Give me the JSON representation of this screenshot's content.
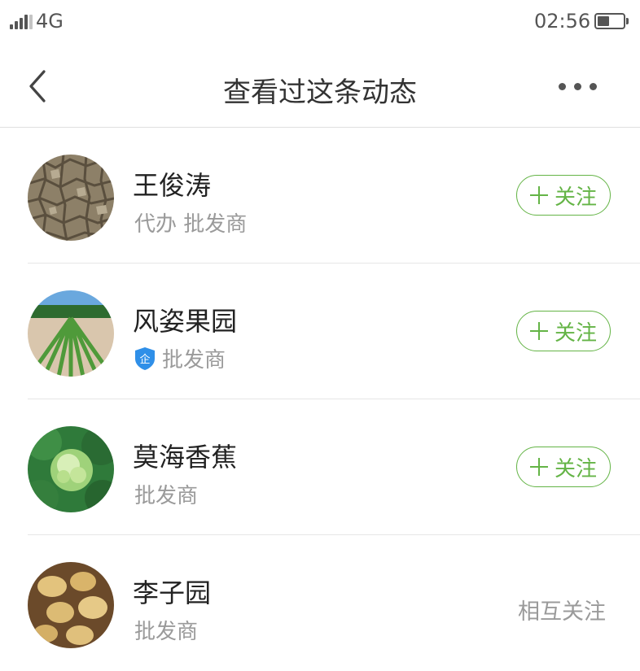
{
  "status_bar": {
    "network": "4G",
    "time": "02:56",
    "battery_level": 0.45
  },
  "header": {
    "title": "查看过这条动态",
    "back_icon": "chevron-left-icon",
    "more_icon": "more-horizontal-icon"
  },
  "colors": {
    "accent": "#64b446",
    "verify_badge": "#2f8fe8",
    "secondary_text": "#9a9a9a",
    "divider": "#e6e6e6"
  },
  "users": [
    {
      "name": "王俊涛",
      "tags": "代办 批发商",
      "action": "+ 关注",
      "action_label": "关注",
      "verified": false,
      "avatar": "cracked-earth-photo"
    },
    {
      "name": "风姿果园",
      "tags": "批发商",
      "action_label": "关注",
      "verified": true,
      "verify_badge": "企",
      "avatar": "crop-field-photo"
    },
    {
      "name": "莫海香蕉",
      "tags": "批发商",
      "action_label": "关注",
      "verified": false,
      "avatar": "green-vegetable-photo"
    },
    {
      "name": "李子园",
      "tags": "批发商",
      "mutual_label": "相互关注",
      "verified": false,
      "avatar": "potatoes-photo"
    }
  ]
}
